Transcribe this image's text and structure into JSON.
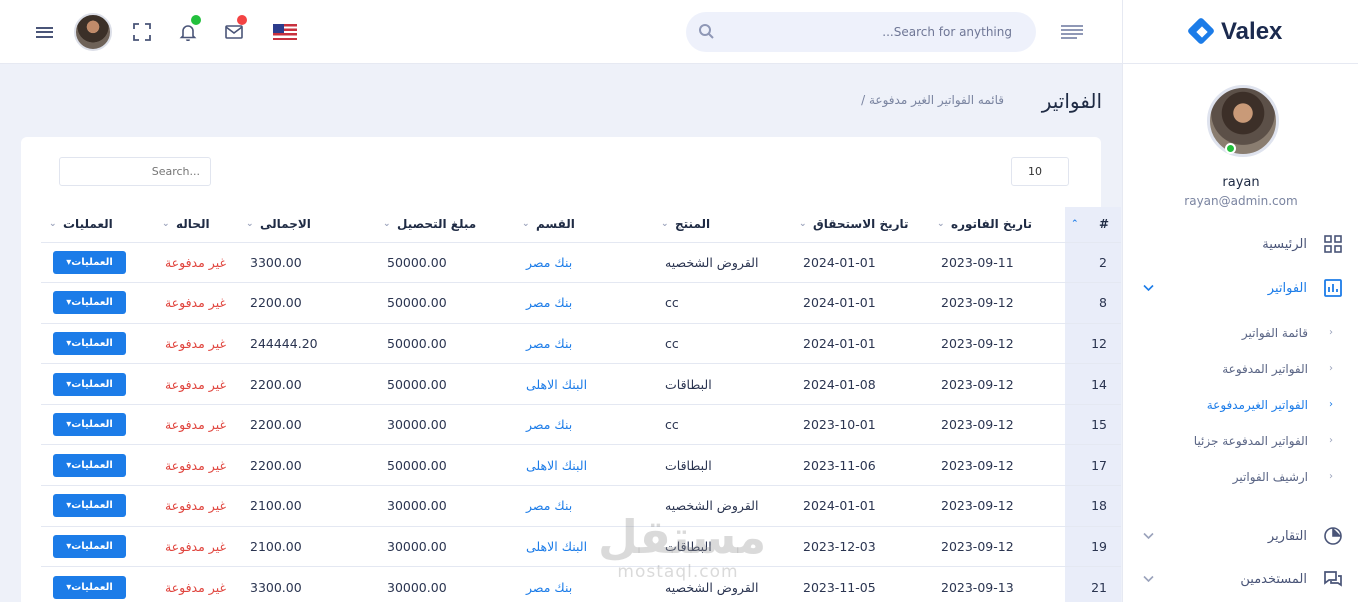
{
  "brand": {
    "name": "Valex",
    "accent": "#1c7ce8"
  },
  "topbar": {
    "search_placeholder": "...Search for anything",
    "icons": [
      "menu-icon",
      "avatar",
      "fullscreen-icon",
      "bell-icon",
      "mail-icon",
      "us-flag-icon",
      "search-icon",
      "sidebar-toggle-icon"
    ],
    "badge_colors": {
      "bell": "#22c03c",
      "mail": "#f34343"
    }
  },
  "profile": {
    "name": "rayan",
    "email": "rayan@admin.com",
    "status_color": "#22c03c"
  },
  "sidebar": {
    "home": "الرئيسية",
    "invoices": "الفواتير",
    "submenu": [
      "قائمة الفواتير",
      "الفواتير المدفوعة",
      "الفواتير الغيرمدفوعة",
      "الفواتير المدفوعة جزئيا",
      "ارشيف الفواتير"
    ],
    "reports": "التقارير",
    "users": "المستخدمين"
  },
  "page": {
    "title": "الفواتير",
    "breadcrumb": "/ قائمه الفواتير الغير مدفوعة"
  },
  "table": {
    "search_placeholder": "Search...",
    "page_length": "10",
    "headers": [
      "#",
      "تاريخ الفاتوره",
      "تاريخ الاستحقاق",
      "المنتج",
      "القسم",
      "مبلغ التحصيل",
      "الاجمالى",
      "الحاله",
      "العمليات"
    ],
    "action_label": "العمليات▾",
    "rows": [
      [
        "2",
        "2023-09-11",
        "2024-01-01",
        "القروض الشخصيه",
        "بنك مصر",
        "50000.00",
        "3300.00",
        "غير مدفوعة"
      ],
      [
        "8",
        "2023-09-12",
        "2024-01-01",
        "cc",
        "بنك مصر",
        "50000.00",
        "2200.00",
        "غير مدفوعة"
      ],
      [
        "12",
        "2023-09-12",
        "2024-01-01",
        "cc",
        "بنك مصر",
        "50000.00",
        "244444.20",
        "غير مدفوعة"
      ],
      [
        "14",
        "2023-09-12",
        "2024-01-08",
        "البطاقات",
        "البنك الاهلى",
        "50000.00",
        "2200.00",
        "غير مدفوعة"
      ],
      [
        "15",
        "2023-09-12",
        "2023-10-01",
        "cc",
        "بنك مصر",
        "30000.00",
        "2200.00",
        "غير مدفوعة"
      ],
      [
        "17",
        "2023-09-12",
        "2023-11-06",
        "البطاقات",
        "البنك الاهلى",
        "50000.00",
        "2200.00",
        "غير مدفوعة"
      ],
      [
        "18",
        "2023-09-12",
        "2024-01-01",
        "القروض الشخصيه",
        "بنك مصر",
        "30000.00",
        "2100.00",
        "غير مدفوعة"
      ],
      [
        "19",
        "2023-09-12",
        "2023-12-03",
        "البطاقات",
        "البنك الاهلى",
        "30000.00",
        "2100.00",
        "غير مدفوعة"
      ],
      [
        "21",
        "2023-09-13",
        "2023-11-05",
        "القروض الشخصيه",
        "بنك مصر",
        "30000.00",
        "3300.00",
        "غير مدفوعة"
      ]
    ]
  },
  "watermark": {
    "arabic": "مستقل",
    "latin": "mostaql.com"
  }
}
